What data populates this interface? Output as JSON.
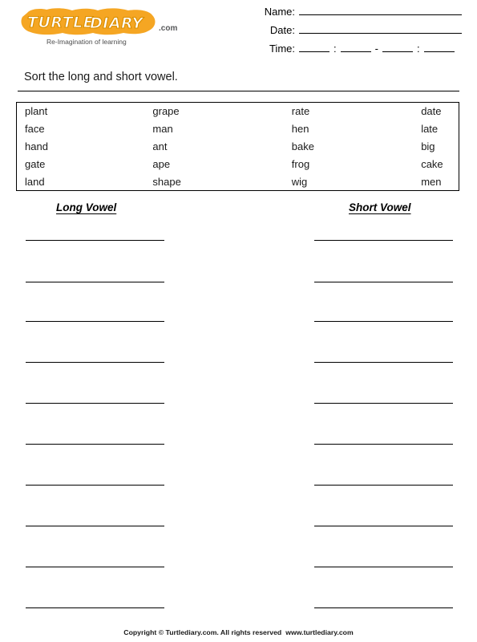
{
  "brand": {
    "logo_text": "TURTLE DIARY",
    "logo_word_1": "TURTLE",
    "logo_word_2": "DIARY",
    "logo_tld": ".com",
    "tagline": "Re-Imagination of learning",
    "logo_fill_color": "#F5A623",
    "logo_letter_color": "#FFFFFF",
    "logo_letter_outline": "#D98E00",
    "tagline_color": "#4D4D4D"
  },
  "header": {
    "fields": [
      {
        "label": "Name:",
        "value": ""
      },
      {
        "label": "Date:",
        "value": ""
      }
    ],
    "time": {
      "label": "Time:",
      "separator_colon": ":",
      "separator_dash": "-",
      "blank_count": 4
    }
  },
  "instruction": {
    "text": "Sort the long and short vowel."
  },
  "word_box": {
    "columns": 4,
    "rows": [
      [
        "plant",
        "grape",
        "rate",
        "date"
      ],
      [
        "face",
        "man",
        "hen",
        "late"
      ],
      [
        "hand",
        "ant",
        "bake",
        "big"
      ],
      [
        "gate",
        "ape",
        "frog",
        "cake"
      ],
      [
        "land",
        "shape",
        "wig",
        "men"
      ]
    ],
    "all_words": [
      "plant",
      "grape",
      "rate",
      "date",
      "face",
      "man",
      "hen",
      "late",
      "hand",
      "ant",
      "bake",
      "big",
      "gate",
      "ape",
      "frog",
      "cake",
      "land",
      "shape",
      "wig",
      "men"
    ]
  },
  "answer_columns": [
    {
      "heading": "Long Vowel",
      "line_count": 10,
      "answers": [
        "",
        "",
        "",
        "",
        "",
        "",
        "",
        "",
        "",
        ""
      ]
    },
    {
      "heading": "Short Vowel",
      "line_count": 10,
      "answers": [
        "",
        "",
        "",
        "",
        "",
        "",
        "",
        "",
        "",
        ""
      ]
    }
  ],
  "answer_line_tops": [
    299,
    351,
    400,
    451,
    502,
    553,
    604,
    655,
    706,
    757
  ],
  "footer": {
    "copyright": "Copyright © Turtlediary.com. All rights reserved",
    "website": "www.turtlediary.com"
  }
}
